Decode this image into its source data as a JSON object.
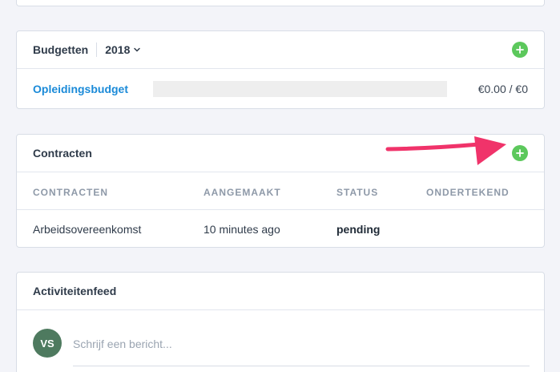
{
  "budgets": {
    "title": "Budgetten",
    "year": "2018",
    "add_icon": "plus-icon",
    "items": [
      {
        "name": "Opleidingsbudget",
        "amount": "€0.00 / €0",
        "progress": 0
      }
    ]
  },
  "contracts": {
    "title": "Contracten",
    "add_icon": "plus-icon",
    "columns": [
      "CONTRACTEN",
      "AANGEMAAKT",
      "STATUS",
      "ONDERTEKEND"
    ],
    "rows": [
      {
        "contract": "Arbeidsovereenkomst",
        "created": "10 minutes ago",
        "status": "pending",
        "signed": ""
      }
    ]
  },
  "feed": {
    "title": "Activiteitenfeed",
    "avatar_initials": "VS",
    "message_placeholder": "Schrijf een bericht..."
  },
  "colors": {
    "accent_link": "#1a8ad8",
    "add_button": "#5cc85c",
    "annotation_arrow": "#f0336a",
    "avatar": "#4e7a5f"
  }
}
